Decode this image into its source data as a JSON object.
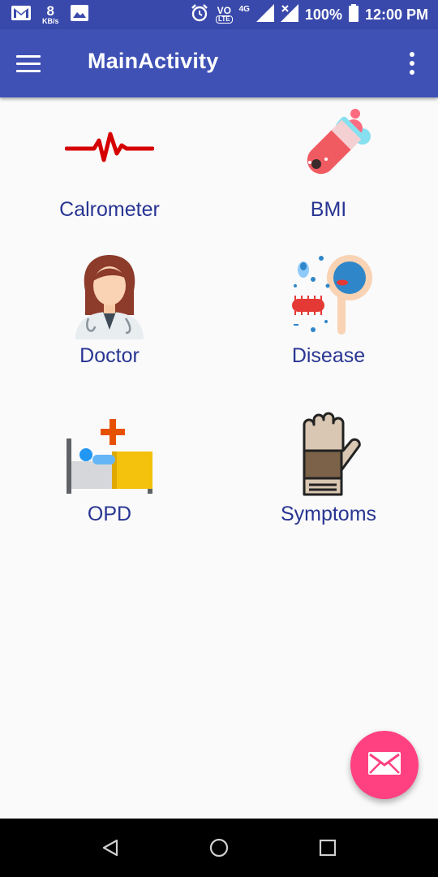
{
  "status_bar": {
    "net_speed_value": "8",
    "net_speed_unit": "KB/s",
    "volte_label": "VO",
    "lte_label": "LTE",
    "network_label": "4G",
    "battery_percent": "100%",
    "time": "12:00 PM"
  },
  "app_bar": {
    "title": "MainActivity"
  },
  "tiles": [
    {
      "label": "Calrometer",
      "icon": "heartbeat-icon"
    },
    {
      "label": "BMI",
      "icon": "test-tube-icon"
    },
    {
      "label": "Doctor",
      "icon": "doctor-icon"
    },
    {
      "label": "Disease",
      "icon": "bacteria-magnifier-icon"
    },
    {
      "label": "OPD",
      "icon": "hospital-bed-icon"
    },
    {
      "label": "Symptoms",
      "icon": "glove-icon"
    }
  ],
  "fab": {
    "icon": "email-icon"
  },
  "nav_bar": {
    "icons": [
      "back-icon",
      "home-icon",
      "recents-icon"
    ]
  },
  "colors": {
    "status_bar": "#3949ab",
    "app_bar": "#3f51b5",
    "label_text": "#283593",
    "fab": "#ff4081",
    "background": "#fafafa"
  }
}
